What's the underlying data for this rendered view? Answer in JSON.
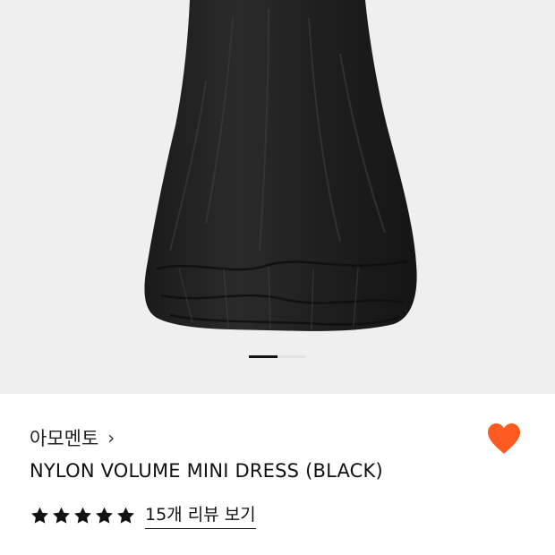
{
  "gallery": {
    "image": "black-nylon-volume-dress-photo",
    "page_count": 2,
    "active_page": 1
  },
  "product": {
    "brand": "아모멘토",
    "brand_chevron": "›",
    "name": "NYLON VOLUME MINI DRESS (BLACK)",
    "rating_stars": 5,
    "reviews_link": "15개 리뷰 보기",
    "wishlisted": true
  },
  "icons": {
    "heart": "heart-icon",
    "star": "star-icon",
    "chevron": "chevron-right-icon"
  },
  "colors": {
    "background": "#ffffff",
    "gallery_bg": "#efefef",
    "heart": "#ff5a1f",
    "star": "#111111"
  }
}
